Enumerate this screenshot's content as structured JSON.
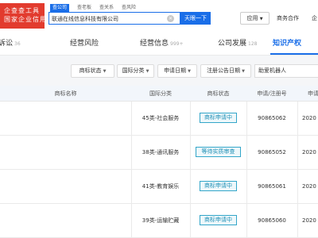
{
  "logo": {
    "line1": "企查查工具",
    "line2": "国家企业信用信息公示系统"
  },
  "search": {
    "tabs": [
      "查公司",
      "查老板",
      "查关系",
      "查风险"
    ],
    "value": "联通在线信息科技有限公司",
    "button": "天眼一下"
  },
  "header_nav": {
    "app": "应用",
    "business": "商务合作",
    "more": "企"
  },
  "category_tabs": [
    {
      "label": "诉讼",
      "count": "36"
    },
    {
      "label": "经营风险",
      "count": ""
    },
    {
      "label": "经营信息",
      "count": "999+"
    },
    {
      "label": "公司发展",
      "count": "128"
    },
    {
      "label": "知识产权",
      "count": ""
    }
  ],
  "filters": {
    "status": "商标状态",
    "class": "国际分类",
    "apply_date": "申请日期",
    "announce_date": "注册公告日期",
    "keyword": "助爱机器人"
  },
  "table": {
    "headers": [
      "商标名称",
      "国际分类",
      "商标状态",
      "申请/注册号",
      "申请"
    ],
    "rows": [
      {
        "class": "45类-社会服务",
        "status": "商标申请中",
        "reg_no": "90865062",
        "date": "2020"
      },
      {
        "class": "38类-通讯服务",
        "status": "等待实质审查",
        "reg_no": "90865052",
        "date": "2020"
      },
      {
        "class": "41类-教育娱乐",
        "status": "商标申请中",
        "reg_no": "90865061",
        "date": "2020"
      },
      {
        "class": "39类-运输贮藏",
        "status": "商标申请中",
        "reg_no": "90865060",
        "date": "2020"
      }
    ]
  },
  "colors": {
    "accent": "#1a6ee8",
    "brand": "#e23b2e",
    "status_border": "#33a6c9"
  },
  "icons": {
    "clear": "clear-icon",
    "dropdown": "caret-down-icon"
  }
}
